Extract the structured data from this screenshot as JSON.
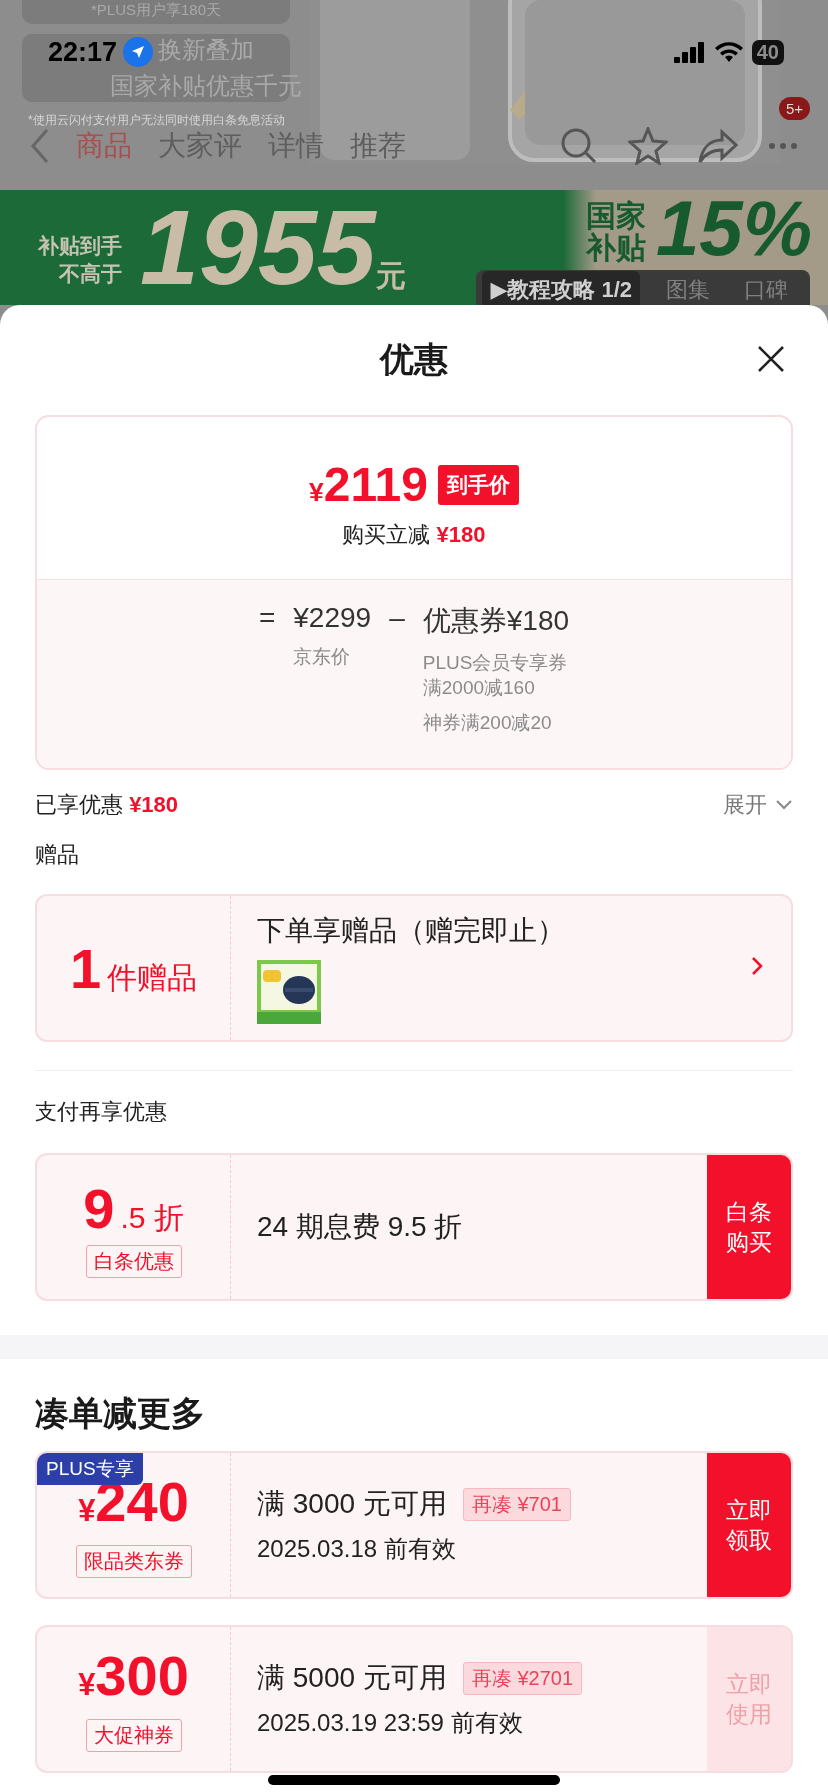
{
  "status_bar": {
    "time": "22:17",
    "battery": "40"
  },
  "background": {
    "promo_cards": [
      {
        "text": "*PLUS用户享180天"
      },
      {
        "text": "换新叠加",
        "subtext": "国家补贴优惠千元"
      }
    ],
    "disclaimer": "*使用云闪付支付用户无法同时使用白条免息活动",
    "nav_tabs": [
      {
        "label": "商品",
        "selected": true
      },
      {
        "label": "大家评",
        "selected": false
      },
      {
        "label": "详情",
        "selected": false
      },
      {
        "label": "推荐",
        "selected": false
      }
    ],
    "cart_badge": "5+",
    "banner": {
      "lead_1": "补贴到手",
      "lead_2": "不高于",
      "price": "1955",
      "unit": "元",
      "tag_1": "国家",
      "tag_2": "补贴",
      "percent": "15%"
    },
    "media_tabs": [
      {
        "label": "▶教程攻略 1/2",
        "selected": true
      },
      {
        "label": "图集",
        "selected": false
      },
      {
        "label": "口碑",
        "selected": false
      }
    ]
  },
  "sheet": {
    "title": "优惠",
    "price_card": {
      "currency": "¥",
      "price": "2119",
      "price_tag": "到手价",
      "saving_label": "购买立减",
      "saving": "¥180",
      "equals": "=",
      "base": "¥2299",
      "base_label": "京东价",
      "minus": "–",
      "coupon": "优惠券¥180",
      "coupon_details": [
        {
          "lines": [
            "PLUS会员专享券",
            "满2000减160"
          ]
        },
        {
          "lines": [
            "神券满200减20"
          ]
        }
      ]
    },
    "enjoyed": {
      "label": "已享优惠",
      "amount": "¥180",
      "toggle": "展开",
      "expanded": false
    },
    "gifts": {
      "heading": "赠品",
      "count": "1",
      "count_label": "件赠品",
      "title": "下单享赠品（赠完即止）"
    },
    "payment": {
      "heading": "支付再享优惠",
      "discount_big": "9",
      "discount_small": ".5 折",
      "tag": "白条优惠",
      "description": "24 期息费 9.5 折",
      "button": "白条购买"
    },
    "bundle": {
      "heading": "凑单减更多",
      "coupons": [
        {
          "badge": "PLUS专享",
          "currency": "¥",
          "amount": "240",
          "type": "限品类东券",
          "condition": "满 3000 元可用",
          "gap": "再凑 ¥701",
          "validity": "2025.03.18 前有效",
          "button": "立即领取",
          "claimed": false
        },
        {
          "currency": "¥",
          "amount": "300",
          "type": "大促神券",
          "condition": "满 5000 元可用",
          "gap": "再凑 ¥2701",
          "validity": "2025.03.19 23:59 前有效",
          "button": "立即使用",
          "claimed": true
        }
      ]
    }
  }
}
